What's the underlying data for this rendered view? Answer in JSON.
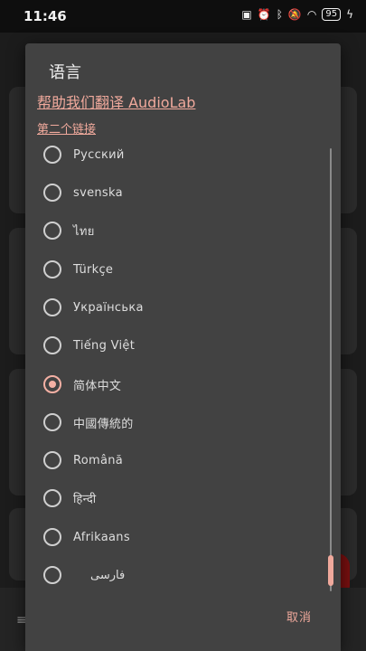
{
  "status_bar": {
    "time": "11:46",
    "battery": "95",
    "icons": [
      "nfc-icon",
      "alarm-icon",
      "bluetooth-icon",
      "mute-icon",
      "wifi-icon",
      "battery-icon",
      "charging-icon"
    ]
  },
  "dialog": {
    "title": "语言",
    "help_link": "帮助我们翻译 AudioLab",
    "second_link": "第二个链接",
    "cancel_label": "取消",
    "languages": [
      {
        "label": "Русский",
        "selected": false
      },
      {
        "label": "svenska",
        "selected": false
      },
      {
        "label": "ไทย",
        "selected": false
      },
      {
        "label": "Türkçe",
        "selected": false
      },
      {
        "label": "Українська",
        "selected": false
      },
      {
        "label": "Tiếng Việt",
        "selected": false
      },
      {
        "label": "简体中文",
        "selected": true
      },
      {
        "label": "中國傳統的",
        "selected": false
      },
      {
        "label": "Română",
        "selected": false
      },
      {
        "label": "हिन्दी",
        "selected": false
      },
      {
        "label": "Afrikaans",
        "selected": false
      },
      {
        "label": "فارسی",
        "selected": false
      }
    ]
  },
  "background": {
    "menu_icon": "≡"
  },
  "colors": {
    "accent": "#f0a99c",
    "dialog_bg": "#424242",
    "scrim": "#1c1c1c"
  }
}
